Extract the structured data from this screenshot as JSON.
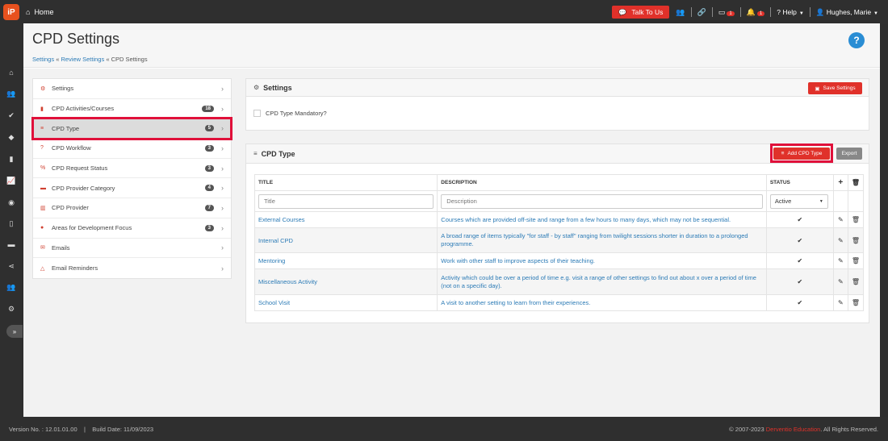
{
  "topbar": {
    "logo": "iP",
    "home_label": "Home",
    "talk_label": "Talk To Us",
    "mail_badge": "1",
    "bell_badge": "1",
    "help_label": "Help",
    "user_name": "Hughes, Marie"
  },
  "header": {
    "title": "CPD Settings",
    "breadcrumb": [
      "Settings",
      "Review Settings",
      "CPD Settings"
    ],
    "help_symbol": "?"
  },
  "menu": [
    {
      "label": "Settings",
      "badge": "",
      "icon": "gears-icon",
      "glyph": "⚙"
    },
    {
      "label": "CPD Activities/Courses",
      "badge": "18",
      "icon": "book-icon",
      "glyph": "▮"
    },
    {
      "label": "CPD Type",
      "badge": "5",
      "icon": "list-icon",
      "glyph": "≡"
    },
    {
      "label": "CPD Workflow",
      "badge": "3",
      "icon": "question-icon",
      "glyph": "?"
    },
    {
      "label": "CPD Request Status",
      "badge": "3",
      "icon": "percent-icon",
      "glyph": "%"
    },
    {
      "label": "CPD Provider Category",
      "badge": "4",
      "icon": "folder-icon",
      "glyph": "▬"
    },
    {
      "label": "CPD Provider",
      "badge": "7",
      "icon": "building-icon",
      "glyph": "▥"
    },
    {
      "label": "Areas for Development Focus",
      "badge": "3",
      "icon": "comments-icon",
      "glyph": "●"
    },
    {
      "label": "Emails",
      "badge": "",
      "icon": "envelope-icon",
      "glyph": "✉"
    },
    {
      "label": "Email Reminders",
      "badge": "",
      "icon": "bell-icon",
      "glyph": "△"
    }
  ],
  "settings_panel": {
    "title": "Settings",
    "save_label": "Save Settings",
    "checkbox_label": "CPD Type Mandatory?"
  },
  "cpd_panel": {
    "title": "CPD Type",
    "add_label": "Add CPD Type",
    "export_label": "Export",
    "columns": {
      "title": "TITLE",
      "description": "DESCRIPTION",
      "status": "STATUS"
    },
    "filter": {
      "title_placeholder": "Title",
      "description_placeholder": "Description",
      "status_value": "Active"
    },
    "rows": [
      {
        "title": "External Courses",
        "description": "Courses which are provided off-site and range from a few hours to many days, which may not be sequential."
      },
      {
        "title": "Internal CPD",
        "description": "A broad range of items typically \"for staff - by staff\" ranging from twilight sessions shorter in duration to a prolonged programme."
      },
      {
        "title": "Mentoring",
        "description": "Work with other staff to improve aspects of their teaching."
      },
      {
        "title": "Miscellaneous Activity",
        "description": "Activity which could be over a period of time e.g. visit a range of other settings to find out about x over a period of time (not on a specific day)."
      },
      {
        "title": "School Visit",
        "description": "A visit to another setting to learn from their experiences."
      }
    ]
  },
  "footer": {
    "version": "Version No. : 12.01.01.00",
    "build": "Build Date: 11/09/2023",
    "copyright_prefix": "© 2007-2023",
    "brand": "Derventio Education",
    "copyright_suffix": ". All Rights Reserved."
  },
  "colors": {
    "accent_red": "#e0312a",
    "link_blue": "#2c7bb6",
    "highlight": "#e0103a"
  }
}
